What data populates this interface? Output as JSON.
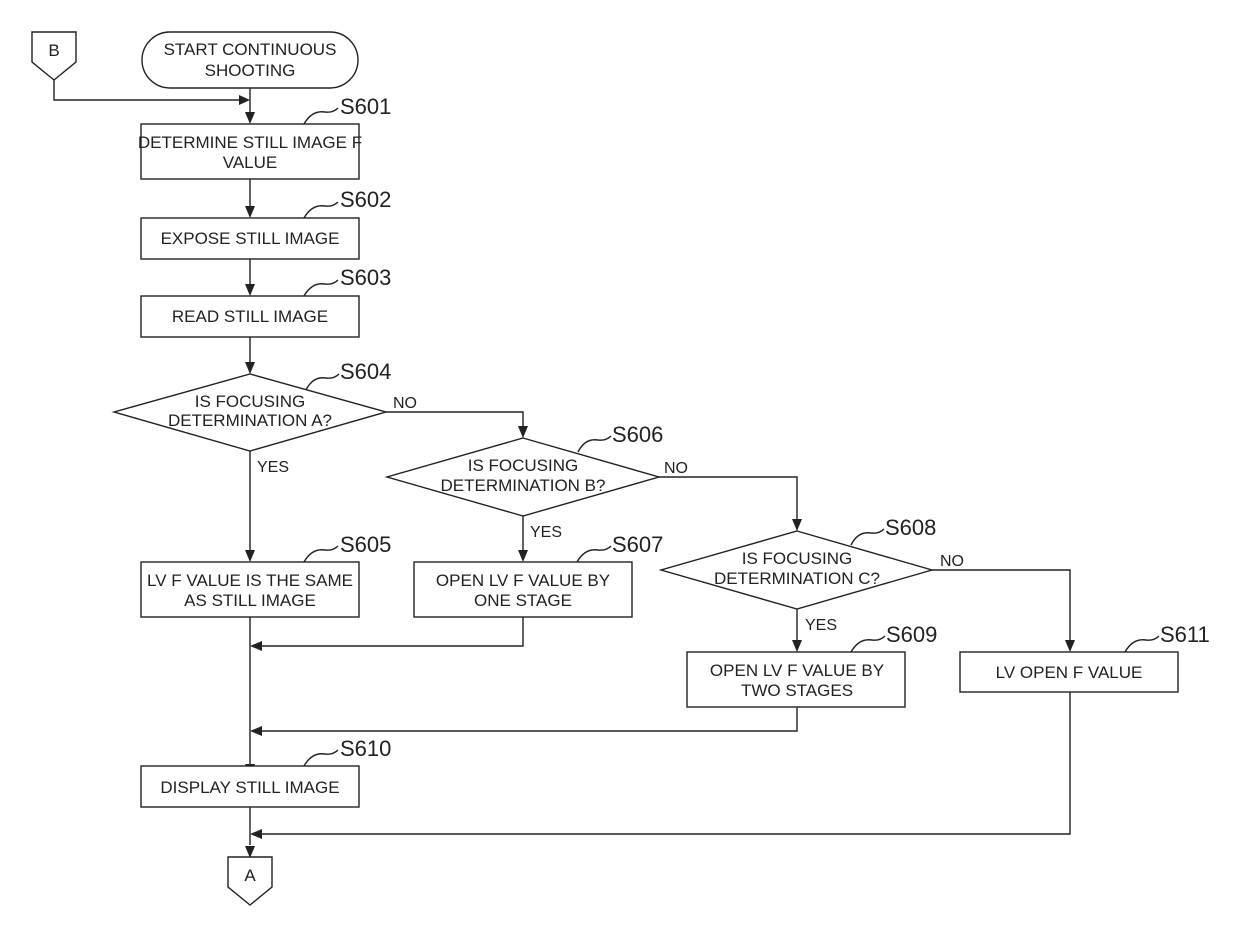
{
  "connectors": {
    "entry": "B",
    "exit": "A"
  },
  "start": {
    "line1": "START CONTINUOUS",
    "line2": "SHOOTING"
  },
  "steps": {
    "s601": {
      "id": "S601",
      "line1": "DETERMINE STILL IMAGE F",
      "line2": "VALUE"
    },
    "s602": {
      "id": "S602",
      "line1": "EXPOSE STILL IMAGE"
    },
    "s603": {
      "id": "S603",
      "line1": "READ STILL IMAGE"
    },
    "s604": {
      "id": "S604",
      "line1": "IS FOCUSING",
      "line2": "DETERMINATION A?"
    },
    "s605": {
      "id": "S605",
      "line1": "LV F VALUE IS THE SAME",
      "line2": "AS STILL IMAGE"
    },
    "s606": {
      "id": "S606",
      "line1": "IS FOCUSING",
      "line2": "DETERMINATION B?"
    },
    "s607": {
      "id": "S607",
      "line1": "OPEN LV F VALUE BY",
      "line2": "ONE STAGE"
    },
    "s608": {
      "id": "S608",
      "line1": "IS FOCUSING",
      "line2": "DETERMINATION C?"
    },
    "s609": {
      "id": "S609",
      "line1": "OPEN LV F VALUE BY",
      "line2": "TWO STAGES"
    },
    "s610": {
      "id": "S610",
      "line1": "DISPLAY STILL IMAGE"
    },
    "s611": {
      "id": "S611",
      "line1": "LV OPEN F VALUE"
    }
  },
  "branch_labels": {
    "yes": "YES",
    "no": "NO"
  }
}
